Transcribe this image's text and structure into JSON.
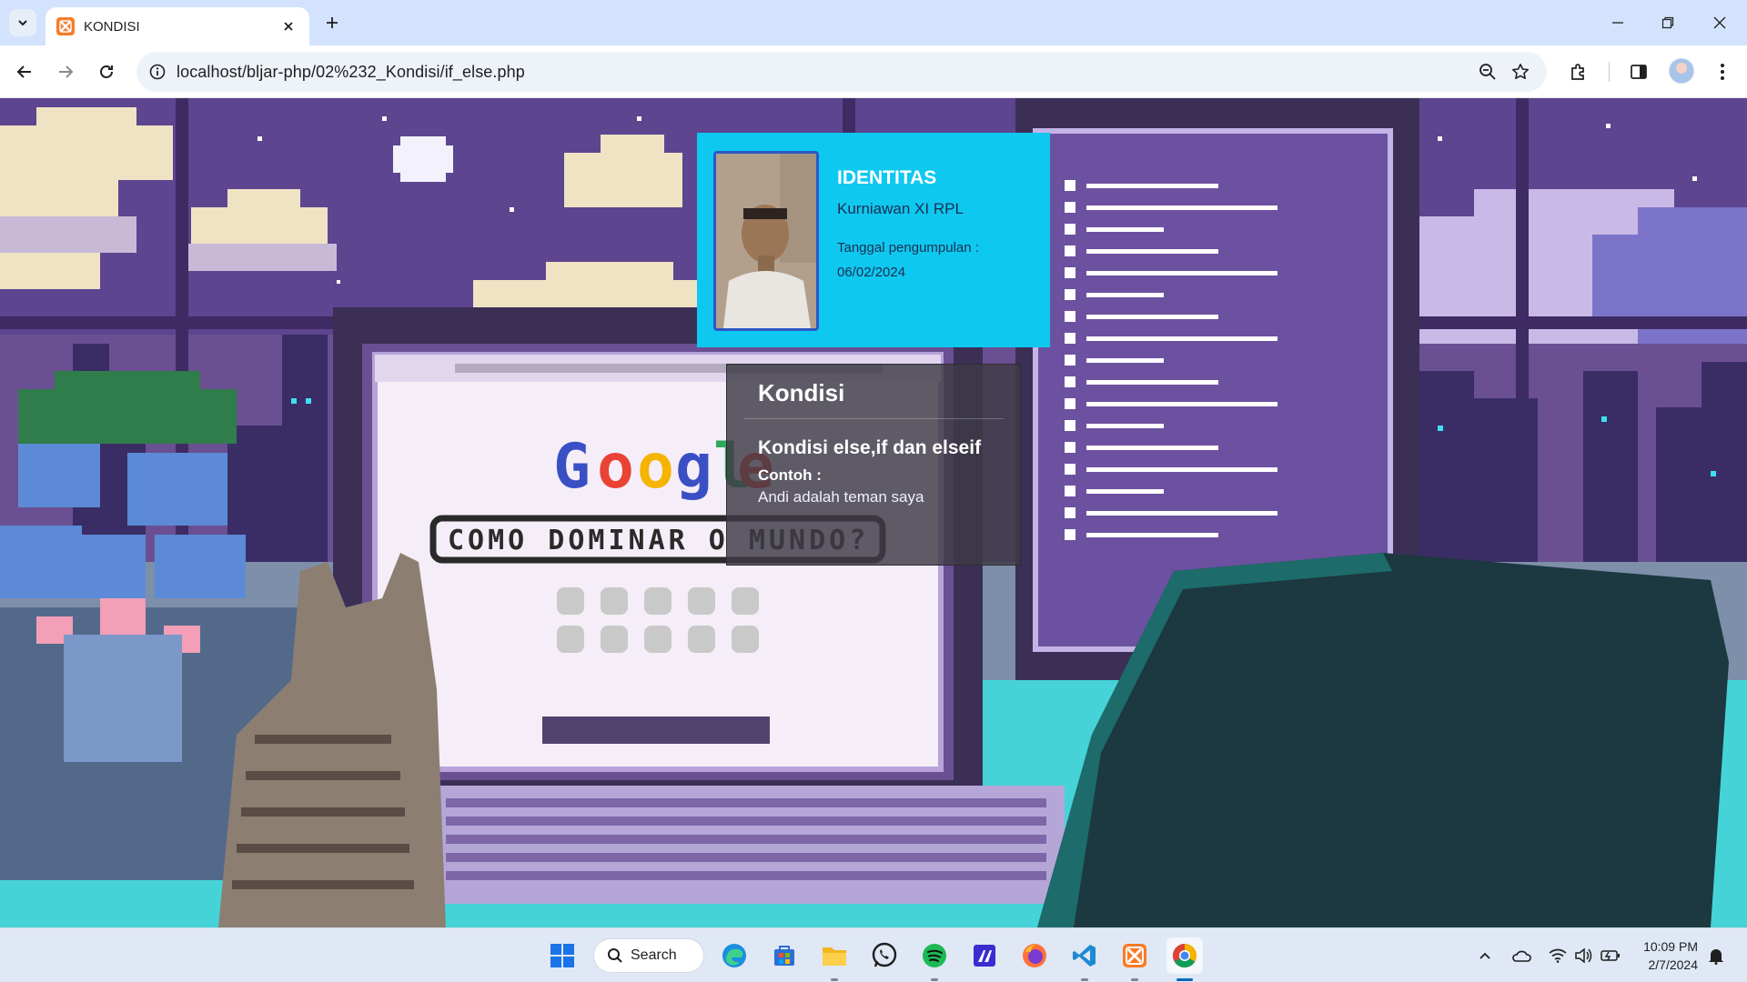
{
  "browser": {
    "tab_title": "KONDISI",
    "url": "localhost/bljar-php/02%232_Kondisi/if_else.php"
  },
  "identitas": {
    "heading": "IDENTITAS",
    "name": "Kurniawan XI RPL",
    "date_label": "Tanggal pengumpulan :",
    "date": "06/02/2024"
  },
  "kondisi": {
    "title": "Kondisi",
    "subtitle": "Kondisi else,if dan elseif",
    "example_label": "Contoh :",
    "example_text": "Andi adalah teman saya"
  },
  "background": {
    "search_text": "COMO DOMINAR O MUNDO?"
  },
  "taskbar": {
    "search_label": "Search",
    "time": "10:09 PM",
    "date": "2/7/2024",
    "apps": [
      "windows-start",
      "search",
      "edge",
      "microsoft-store",
      "file-explorer",
      "whatsapp",
      "spotify",
      "editor",
      "firefox",
      "vscode",
      "xampp",
      "chrome"
    ]
  }
}
